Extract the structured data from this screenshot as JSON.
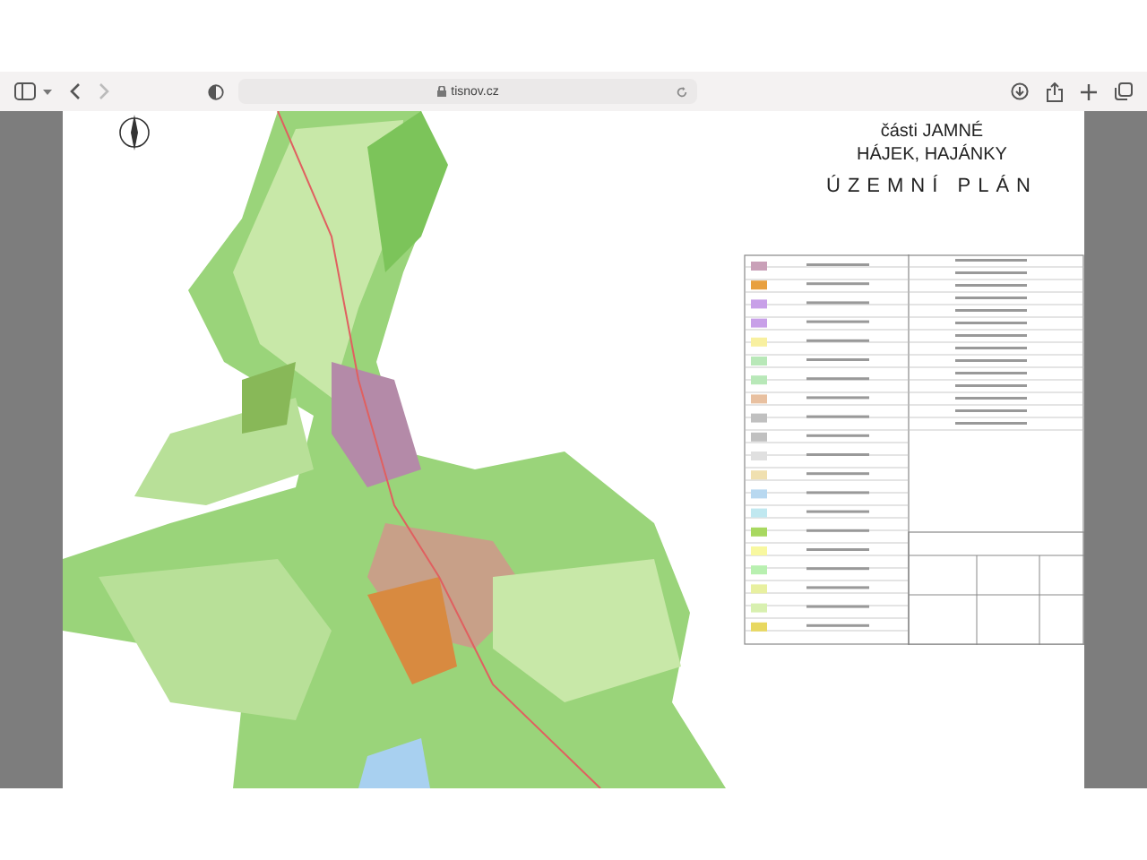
{
  "browser": {
    "address": "tisnov.cz"
  },
  "document": {
    "title_lines": [
      "části JAMNÉ",
      "HÁJEK, HAJÁNKY"
    ],
    "heading": "ÚZEMNÍ PLÁN"
  }
}
